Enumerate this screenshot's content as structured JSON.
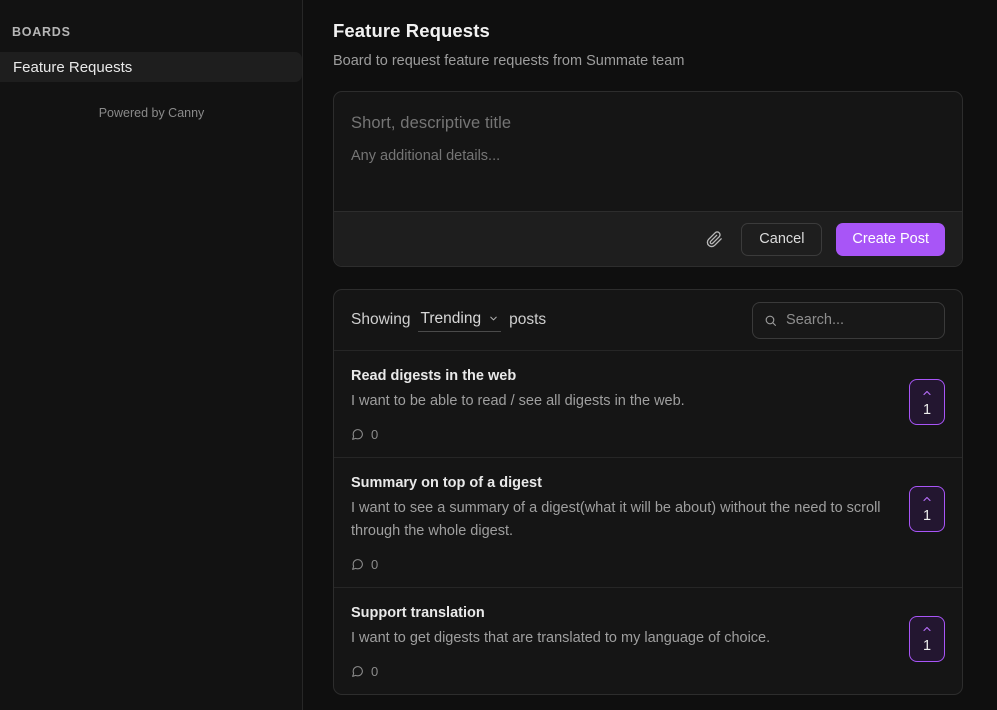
{
  "sidebar": {
    "section_label": "BOARDS",
    "items": [
      {
        "label": "Feature Requests",
        "active": true
      }
    ],
    "footer": "Powered by Canny"
  },
  "header": {
    "title": "Feature Requests",
    "subtitle": "Board to request feature requests from Summate team"
  },
  "compose": {
    "title_placeholder": "Short, descriptive title",
    "title_value": "",
    "details_placeholder": "Any additional details...",
    "details_value": "",
    "attach_icon": "paperclip-icon",
    "cancel_label": "Cancel",
    "create_label": "Create Post",
    "accent_color": "#a855f7"
  },
  "list": {
    "showing_label": "Showing",
    "sort_value": "Trending",
    "posts_label": "posts",
    "search_placeholder": "Search...",
    "search_value": "",
    "search_icon": "search-icon",
    "posts": [
      {
        "title": "Read digests in the web",
        "description": "I want to be able to read / see all digests in the web.",
        "comments": "0",
        "votes": "1"
      },
      {
        "title": "Summary on top of a digest",
        "description": "I want to see a summary of a digest(what it will be about) without the need to scroll through the whole digest.",
        "comments": "0",
        "votes": "1"
      },
      {
        "title": "Support translation",
        "description": "I want to get digests that are translated to my language of choice.",
        "comments": "0",
        "votes": "1"
      }
    ]
  }
}
